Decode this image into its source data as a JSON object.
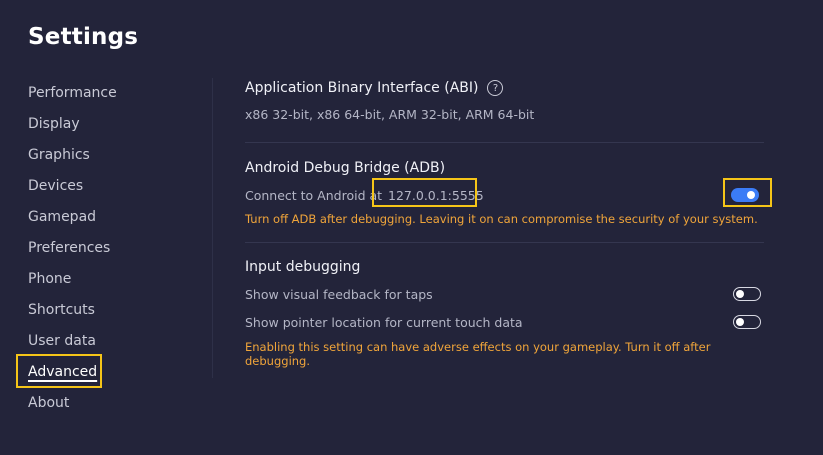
{
  "page_title": "Settings",
  "sidebar": {
    "items": [
      {
        "label": "Performance"
      },
      {
        "label": "Display"
      },
      {
        "label": "Graphics"
      },
      {
        "label": "Devices"
      },
      {
        "label": "Gamepad"
      },
      {
        "label": "Preferences"
      },
      {
        "label": "Phone"
      },
      {
        "label": "Shortcuts"
      },
      {
        "label": "User data"
      },
      {
        "label": "Advanced",
        "active": true
      },
      {
        "label": "About"
      }
    ]
  },
  "abi": {
    "title": "Application Binary Interface (ABI)",
    "help_icon": "?",
    "value": "x86 32-bit, x86 64-bit, ARM 32-bit, ARM 64-bit"
  },
  "adb": {
    "title": "Android Debug Bridge (ADB)",
    "connect_label": "Connect to Android at",
    "address": "127.0.0.1:5555",
    "enabled": true,
    "warning": "Turn off ADB after debugging. Leaving it on can compromise the security of your system."
  },
  "input_debugging": {
    "title": "Input debugging",
    "options": [
      {
        "label": "Show visual feedback for taps",
        "enabled": false
      },
      {
        "label": "Show pointer location for current touch data",
        "enabled": false
      }
    ],
    "warning": "Enabling this setting can have adverse effects on your gameplay. Turn it off after debugging."
  },
  "colors": {
    "background": "#23243a",
    "highlight": "#f5c518",
    "accent": "#3b7cf6",
    "warning": "#f0a53a"
  }
}
